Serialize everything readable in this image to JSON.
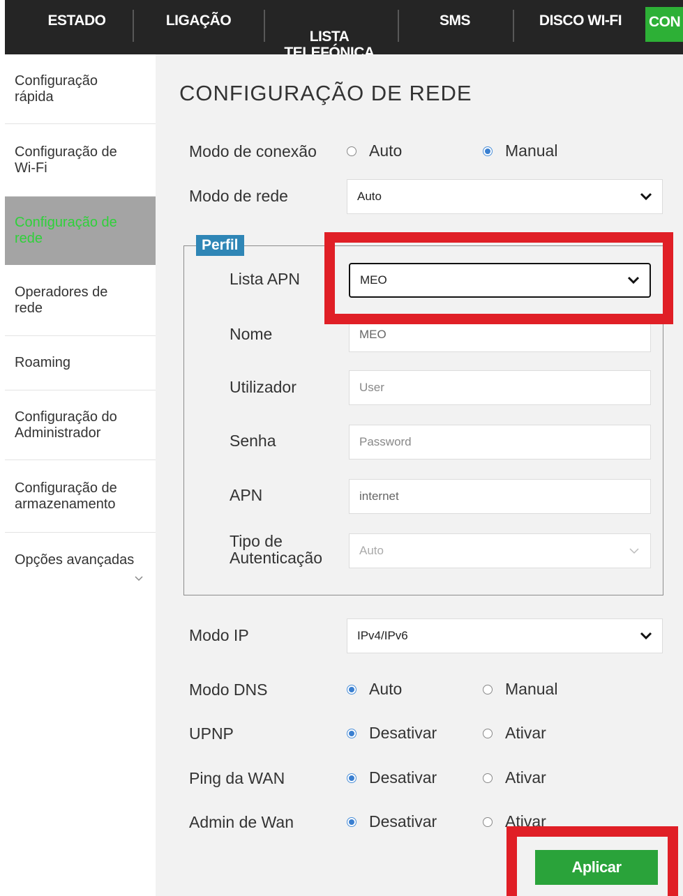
{
  "topnav": {
    "items": [
      {
        "label": "ESTADO"
      },
      {
        "label": "LIGAÇÃO"
      },
      {
        "label": "LISTA\nTELEFÓNICA"
      },
      {
        "label": "SMS"
      },
      {
        "label": "DISCO WI-FI"
      },
      {
        "label": "CON"
      }
    ],
    "active_color": "#2db036"
  },
  "sidebar": {
    "items": [
      {
        "label": "Configuração rápida"
      },
      {
        "label": "Configuração de Wi-Fi"
      },
      {
        "label": "Configuração de rede"
      },
      {
        "label": "Operadores de rede"
      },
      {
        "label": "Roaming"
      },
      {
        "label": "Configuração do Administrador"
      },
      {
        "label": "Configuração de armazenamento"
      },
      {
        "label": "Opções avançadas"
      }
    ],
    "more_icon": "chevron-down-icon"
  },
  "page": {
    "title": "CONFIGURAÇÃO DE REDE",
    "connection_mode": {
      "label": "Modo de conexão",
      "options": [
        "Auto",
        "Manual"
      ],
      "selected": "Manual"
    },
    "network_mode": {
      "label": "Modo de rede",
      "value": "Auto"
    },
    "profile": {
      "legend": "Perfil",
      "apn_list": {
        "label": "Lista APN",
        "value": "MEO"
      },
      "name": {
        "label": "Nome",
        "value": "MEO"
      },
      "user": {
        "label": "Utilizador",
        "placeholder": "User"
      },
      "password": {
        "label": "Senha",
        "placeholder": "Password"
      },
      "apn": {
        "label": "APN",
        "value": "internet"
      },
      "auth_type": {
        "label": "Tipo de Autenticação",
        "value": "Auto"
      }
    },
    "ip_mode": {
      "label": "Modo IP",
      "value": "IPv4/IPv6"
    },
    "dns_mode": {
      "label": "Modo DNS",
      "options": [
        "Auto",
        "Manual"
      ],
      "selected": "Auto"
    },
    "upnp": {
      "label": "UPNP",
      "options": [
        "Desativar",
        "Ativar"
      ],
      "selected": "Desativar"
    },
    "wan_ping": {
      "label": "Ping da WAN",
      "options": [
        "Desativar",
        "Ativar"
      ],
      "selected": "Desativar"
    },
    "wan_admin": {
      "label": "Admin de Wan",
      "options": [
        "Desativar",
        "Ativar"
      ],
      "selected": "Desativar"
    },
    "apply_label": "Aplicar"
  },
  "colors": {
    "topbar": "#252525",
    "accent_green": "#2aa33a",
    "legend_blue": "#2f86b6",
    "highlight_red": "#e01f26",
    "sidebar_active_bg": "#a4a4a4",
    "sidebar_active_text": "#2fd13a"
  }
}
